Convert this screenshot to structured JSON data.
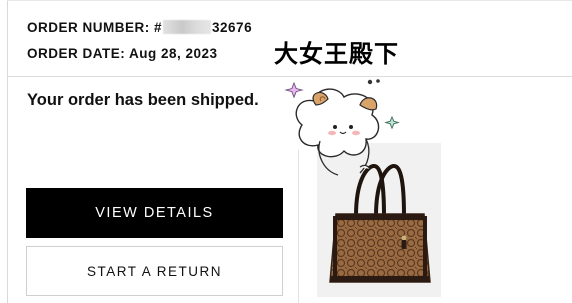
{
  "order": {
    "number_label": "ORDER NUMBER:",
    "number_prefix": "#",
    "number_suffix": "32676",
    "date_label": "ORDER DATE:",
    "date_value": "Aug 28, 2023"
  },
  "sticker_title": "大女王殿下",
  "status_message": "Your order has been shipped.",
  "actions": {
    "view_details": "VIEW DETAILS",
    "start_return": "START A RETURN"
  },
  "colors": {
    "primary_button": "#000000",
    "bag_brown": "#8a5a35",
    "bag_leather": "#2a1a12"
  }
}
